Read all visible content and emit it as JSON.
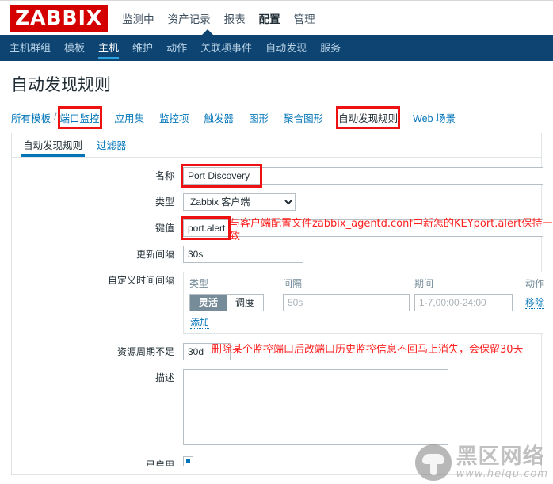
{
  "brand": {
    "logo": "ZABBIX",
    "logo_bg": "#d40000"
  },
  "top_menu": [
    {
      "label": "监测中",
      "active": false
    },
    {
      "label": "资产记录",
      "active": false
    },
    {
      "label": "报表",
      "active": false
    },
    {
      "label": "配置",
      "active": true
    },
    {
      "label": "管理",
      "active": false
    }
  ],
  "nav_menu": [
    {
      "label": "主机群组",
      "active": false
    },
    {
      "label": "模板",
      "active": false
    },
    {
      "label": "主机",
      "active": true
    },
    {
      "label": "维护",
      "active": false
    },
    {
      "label": "动作",
      "active": false
    },
    {
      "label": "关联项事件",
      "active": false
    },
    {
      "label": "自动发现",
      "active": false
    },
    {
      "label": "服务",
      "active": false
    }
  ],
  "page": {
    "title": "自动发现规则"
  },
  "object_tabs": {
    "crumb_root": "所有模板",
    "crumb_sep": "/",
    "crumb_host": "端口监控",
    "items": [
      {
        "label": "应用集",
        "current": false
      },
      {
        "label": "监控项",
        "current": false
      },
      {
        "label": "触发器",
        "current": false
      },
      {
        "label": "图形",
        "current": false
      },
      {
        "label": "聚合图形",
        "current": false
      },
      {
        "label": "自动发现规则",
        "current": true
      },
      {
        "label": "Web 场景",
        "current": false
      }
    ]
  },
  "sub_tabs": [
    {
      "label": "自动发现规则",
      "active": true
    },
    {
      "label": "过滤器",
      "active": false
    }
  ],
  "form": {
    "name": {
      "label": "名称",
      "value": "Port Discovery"
    },
    "type": {
      "label": "类型",
      "value": "Zabbix 客户端"
    },
    "key": {
      "label": "键值",
      "value": "port.alert"
    },
    "update_interval": {
      "label": "更新间隔",
      "value": "30s"
    },
    "custom_intervals": {
      "label": "自定义时间间隔",
      "headers": {
        "type": "类型",
        "interval": "间隔",
        "period": "期间",
        "action": "动作"
      },
      "rows": [
        {
          "toggle_flexible": "灵活",
          "toggle_scheduling": "调度",
          "selected": "灵活",
          "interval_placeholder": "50s",
          "interval_value": "",
          "period_placeholder": "1-7,00:00-24:00",
          "period_value": "",
          "action": "移除"
        }
      ],
      "add_label": "添加"
    },
    "history_storage": {
      "label": "资源周期不足",
      "value": "30d"
    },
    "description": {
      "label": "描述",
      "value": ""
    },
    "enabled": {
      "label": "已启用",
      "checked": true
    }
  },
  "annotations": [
    {
      "id": "key-note",
      "text": "与客户端配置文件zabbix_agentd.conf中新怎的KEYport.alert保持一致"
    },
    {
      "id": "history-note",
      "text": "删除某个监控端口后改端口历史监控信息不回马上消失，会保留30天"
    }
  ],
  "watermark": {
    "cn": "黑区网络",
    "url": "www.heiqu.com"
  }
}
